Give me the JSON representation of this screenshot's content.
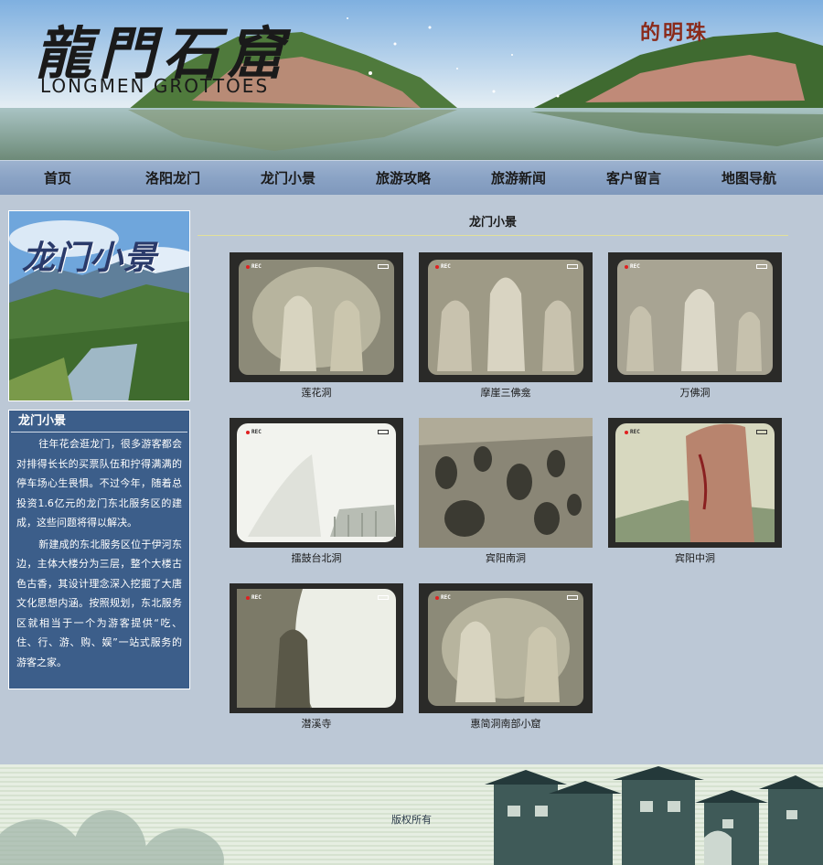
{
  "header": {
    "logo_cn": "龍門石窟",
    "logo_en": "LONGMEN GROTTOES",
    "slogan": "的明珠"
  },
  "nav": {
    "items": [
      "首页",
      "洛阳龙门",
      "龙门小景",
      "旅游攻略",
      "旅游新闻",
      "客户留言",
      "地图导航"
    ]
  },
  "sidebar": {
    "image_title": "龙门小景",
    "box_title": "龙门小景",
    "paragraphs": [
      "往年花会逛龙门，很多游客都会对排得长长的买票队伍和拧得满满的停车场心生畏惧。不过今年，随着总投资1.6亿元的龙门东北服务区的建成，这些问题将得以解决。",
      "新建成的东北服务区位于伊河东边，主体大楼分为三层，整个大楼古色古香，其设计理念深入挖掘了大唐文化思想内涵。按照规划，东北服务区就相当于一个为游客提供“吃、住、行、游、购、娱”一站式服务的游客之家。"
    ]
  },
  "content": {
    "title": "龙门小景",
    "rec_label": "REC",
    "items": [
      {
        "caption": "莲花洞"
      },
      {
        "caption": "摩崖三佛龛"
      },
      {
        "caption": "万佛洞"
      },
      {
        "caption": "擂鼓台北洞"
      },
      {
        "caption": "宾阳南洞"
      },
      {
        "caption": "宾阳中洞"
      },
      {
        "caption": "潜溪寺"
      },
      {
        "caption": "惠简洞南部小窟"
      }
    ]
  },
  "footer": {
    "copyright": "版权所有"
  },
  "colors": {
    "nav_bg": "#8aa3c5",
    "page_bg": "#bcc8d6",
    "sidebar_box": "#3c5e8a",
    "divider": "#e2e09a"
  }
}
